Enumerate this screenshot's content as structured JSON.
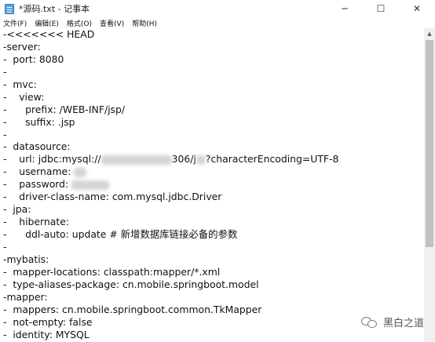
{
  "window": {
    "title": "*源码.txt - 记事本",
    "minimize": "─",
    "maximize": "☐",
    "close": "✕"
  },
  "menu": [
    "文件(F)",
    "编辑(E)",
    "格式(O)",
    "查看(V)",
    "帮助(H)"
  ],
  "editor": {
    "lines": [
      "-<<<<<<< HEAD",
      "-server:",
      "-  port: 8080",
      "-",
      "-  mvc:",
      "-    view:",
      "-      prefix: /WEB-INF/jsp/",
      "-      suffix: .jsp",
      "-",
      "-  datasource:",
      [
        "-    url: jdbc:mysql://",
        90,
        "306/j",
        12,
        "?characterEncoding=UTF-8"
      ],
      [
        "-    username: ",
        16
      ],
      [
        "-    password: ",
        48
      ],
      "-    driver-class-name: com.mysql.jdbc.Driver",
      "-  jpa:",
      "-    hibernate:",
      "-      ddl-auto: update # 新增数据库链接必备的参数",
      "-",
      "-mybatis:",
      "-  mapper-locations: classpath:mapper/*.xml",
      "-  type-aliases-package: cn.mobile.springboot.model",
      "-mapper:",
      "-  mappers: cn.mobile.springboot.common.TkMapper",
      "-  not-empty: false",
      "-  identity: MYSQL"
    ]
  },
  "watermark": {
    "text": "黑白之道",
    "icon": "wechat-icon"
  },
  "scrollbar": {
    "up_arrow": "▲"
  }
}
